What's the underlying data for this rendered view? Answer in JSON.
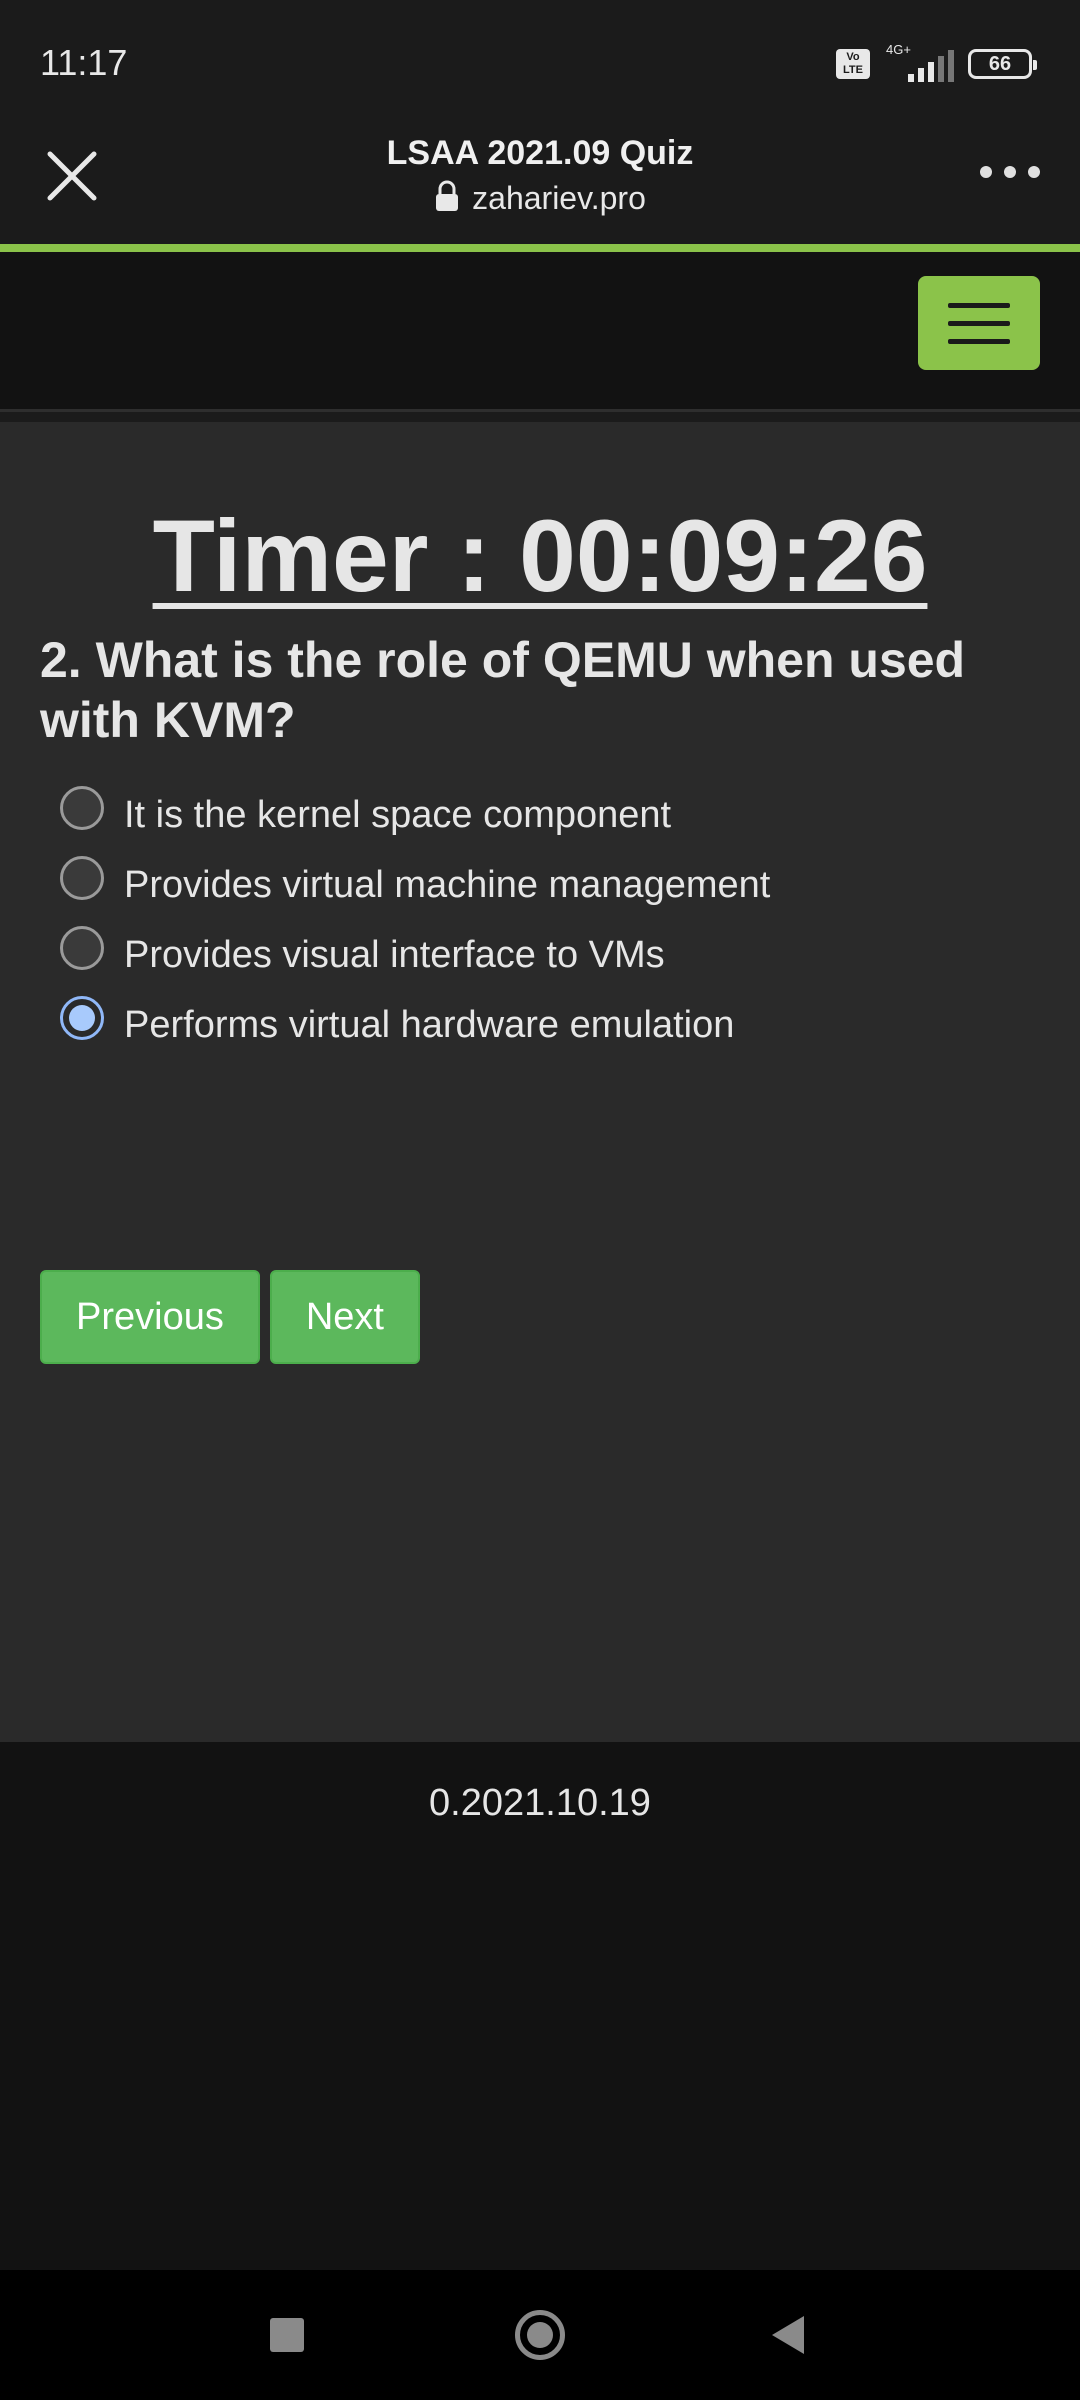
{
  "status_bar": {
    "time": "11:17",
    "volte_label": "Vo LTE",
    "network_label": "4G+",
    "battery_level": "66"
  },
  "browser": {
    "page_title": "LSAA 2021.09 Quiz",
    "url": "zahariev.pro",
    "close_icon": "close-icon",
    "lock_icon": "lock-icon",
    "menu_icon": "more-dots-icon",
    "accent_color": "#8bc34a"
  },
  "site_nav": {
    "menu_icon": "hamburger-icon"
  },
  "quiz": {
    "timer": "Timer : 00:09:26",
    "question": "2. What is the role of QEMU when used with KVM?",
    "answers": [
      {
        "label": "It is the kernel space component",
        "selected": false
      },
      {
        "label": "Provides virtual machine management",
        "selected": false
      },
      {
        "label": "Provides visual interface to VMs",
        "selected": false
      },
      {
        "label": "Performs virtual hardware emulation",
        "selected": true
      }
    ],
    "previous_label": "Previous",
    "next_label": "Next",
    "button_color": "#5cb85c"
  },
  "footer": {
    "version": "0.2021.10.19"
  },
  "system_nav": {
    "recents_icon": "recents-square-icon",
    "home_icon": "home-circle-icon",
    "back_icon": "back-triangle-icon"
  }
}
